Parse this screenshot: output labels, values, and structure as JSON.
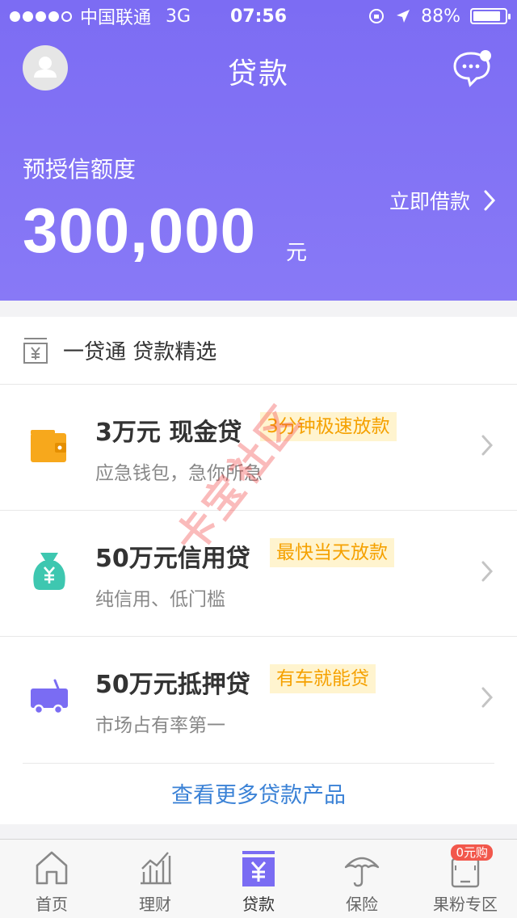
{
  "status": {
    "carrier": "中国联通",
    "network": "3G",
    "time": "07:56",
    "battery": "88%",
    "battery_level": 0.88
  },
  "header": {
    "title": "贷款"
  },
  "credit": {
    "label": "预授信额度",
    "amount": "300,000",
    "unit": "元",
    "borrow_label": "立即借款"
  },
  "section": {
    "title": "一贷通 贷款精选"
  },
  "loans": [
    {
      "title": "3万元 现金贷",
      "tag": "3分钟极速放款",
      "subtitle": "应急钱包，急你所急",
      "icon": "wallet-icon",
      "color": "#f7a81c"
    },
    {
      "title": "50万元信用贷",
      "tag": "最快当天放款",
      "subtitle": "纯信用、低门槛",
      "icon": "money-bag-icon",
      "color": "#3ec7b0"
    },
    {
      "title": "50万元抵押贷",
      "tag": "有车就能贷",
      "subtitle": "市场占有率第一",
      "icon": "car-icon",
      "color": "#7a6cf3"
    }
  ],
  "more_label": "查看更多贷款产品",
  "watermark": "卡宝社区",
  "tabs": [
    {
      "label": "首页",
      "icon": "home-icon"
    },
    {
      "label": "理财",
      "icon": "chart-icon"
    },
    {
      "label": "贷款",
      "icon": "loan-icon"
    },
    {
      "label": "保险",
      "icon": "umbrella-icon"
    },
    {
      "label": "果粉专区",
      "icon": "phone-icon",
      "badge": "0元购"
    }
  ],
  "colors": {
    "brand": "#7c6cf3",
    "tag_text": "#f5a100",
    "tag_bg": "#fff4cf",
    "link": "#3b82d6"
  }
}
